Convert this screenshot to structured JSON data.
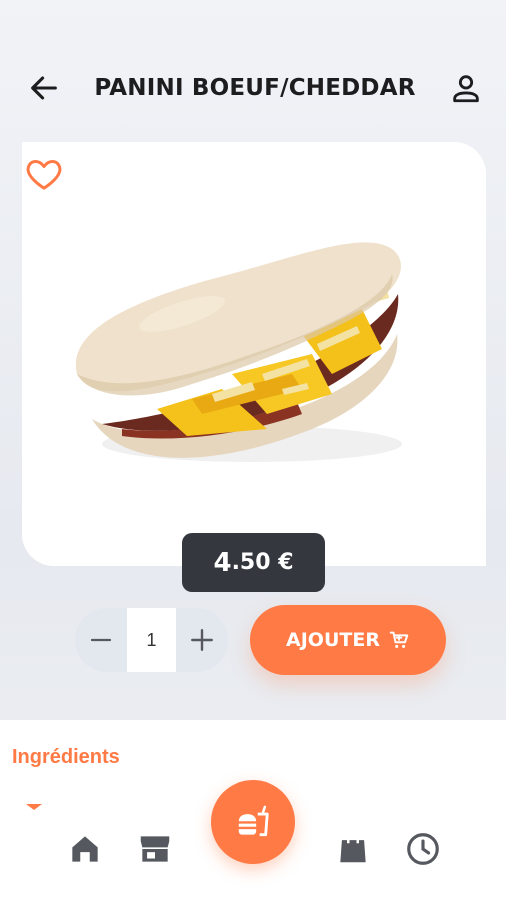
{
  "header": {
    "title": "PANINI BOEUF/CHEDDAR",
    "back_icon": "arrow-left-icon",
    "profile_icon": "user-icon"
  },
  "product": {
    "favorite_icon": "heart-outline-icon",
    "image_alt": "panini-sandwich",
    "price_int": "4",
    "price_rest": ".50 €"
  },
  "quantity": {
    "minus": "−",
    "value": "1",
    "plus": "+"
  },
  "add_button": {
    "label": "AJOUTER",
    "icon": "cart-icon"
  },
  "details": {
    "ingredients_label": "Ingrédients"
  },
  "bottom_nav": {
    "items": [
      "home-icon",
      "store-icon",
      "burger-drink-icon",
      "bag-icon",
      "clock-icon"
    ]
  },
  "colors": {
    "accent": "#ff7a45",
    "dark": "#34373d",
    "icon": "#55585e"
  }
}
